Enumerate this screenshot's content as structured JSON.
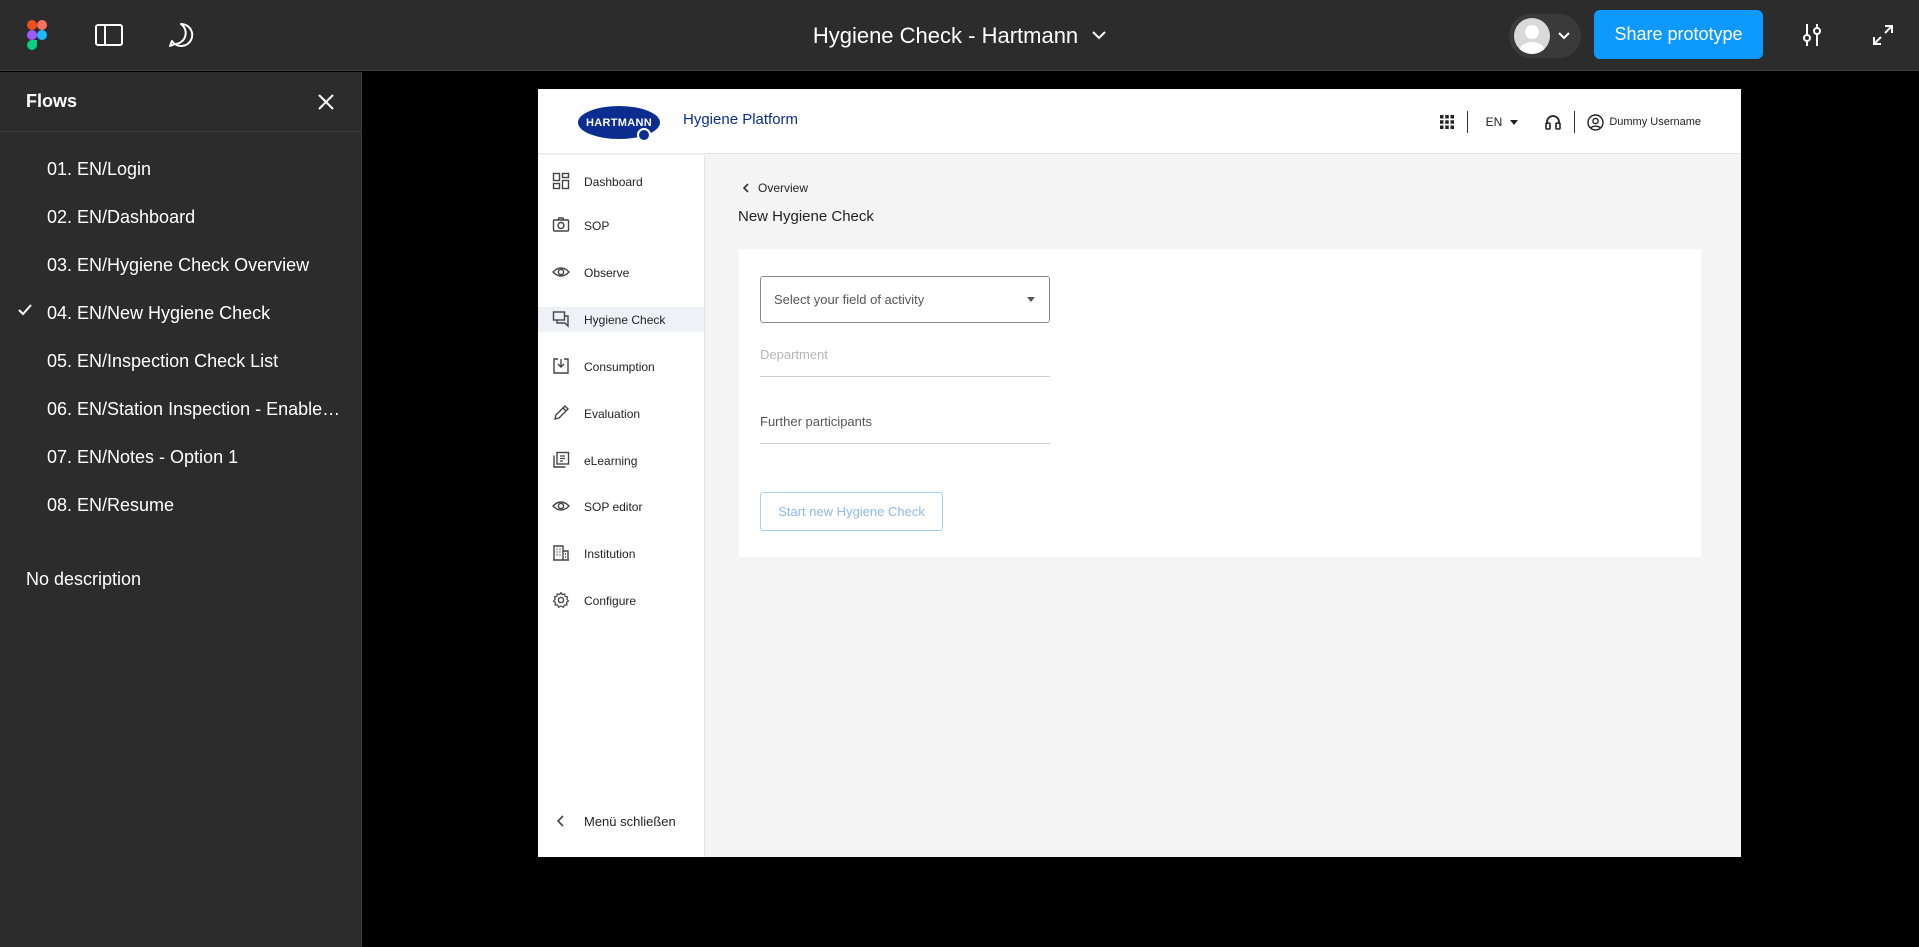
{
  "topbar": {
    "title": "Hygiene Check - Hartmann",
    "share_label": "Share prototype",
    "icons": [
      "figma-logo-icon",
      "sidebar-toggle-icon",
      "comment-icon",
      "chevron-down-icon",
      "settings-sliders-icon",
      "fullscreen-icon"
    ]
  },
  "flows": {
    "header": "Flows",
    "items": [
      {
        "label": "01. EN/Login",
        "active": false
      },
      {
        "label": "02. EN/Dashboard",
        "active": false
      },
      {
        "label": "03. EN/Hygiene Check Overview",
        "active": false
      },
      {
        "label": "04. EN/New Hygiene Check",
        "active": true
      },
      {
        "label": "05. EN/Inspection Check List",
        "active": false
      },
      {
        "label": "06. EN/Station Inspection - Enabled ...",
        "active": false
      },
      {
        "label": "07. EN/Notes - Option 1",
        "active": false
      },
      {
        "label": "08. EN/Resume",
        "active": false
      }
    ],
    "description": "No description"
  },
  "prototype": {
    "logo_text": "HARTMANN",
    "platform_name": "Hygiene Platform",
    "language": "EN",
    "username": "Dummy Username",
    "nav": [
      {
        "label": "Dashboard",
        "icon": "dashboard-icon",
        "active": false
      },
      {
        "label": "SOP",
        "icon": "camera-icon",
        "active": false
      },
      {
        "label": "Observe",
        "icon": "eye-icon",
        "active": false
      },
      {
        "label": "Hygiene Check",
        "icon": "chat-icon",
        "active": true
      },
      {
        "label": "Consumption",
        "icon": "download-box-icon",
        "active": false
      },
      {
        "label": "Evaluation",
        "icon": "pencil-icon",
        "active": false
      },
      {
        "label": "eLearning",
        "icon": "library-icon",
        "active": false
      },
      {
        "label": "SOP editor",
        "icon": "eye-icon",
        "active": false
      },
      {
        "label": "Institution",
        "icon": "building-icon",
        "active": false
      },
      {
        "label": "Configure",
        "icon": "gear-icon",
        "active": false
      }
    ],
    "close_menu": "Menü schließen",
    "breadcrumb": "Overview",
    "page_title": "New Hygiene Check",
    "form": {
      "field_of_activity_placeholder": "Select your field of activity",
      "department_placeholder": "Department",
      "participants_label": "Further participants",
      "start_label": "Start new Hygiene Check"
    }
  }
}
